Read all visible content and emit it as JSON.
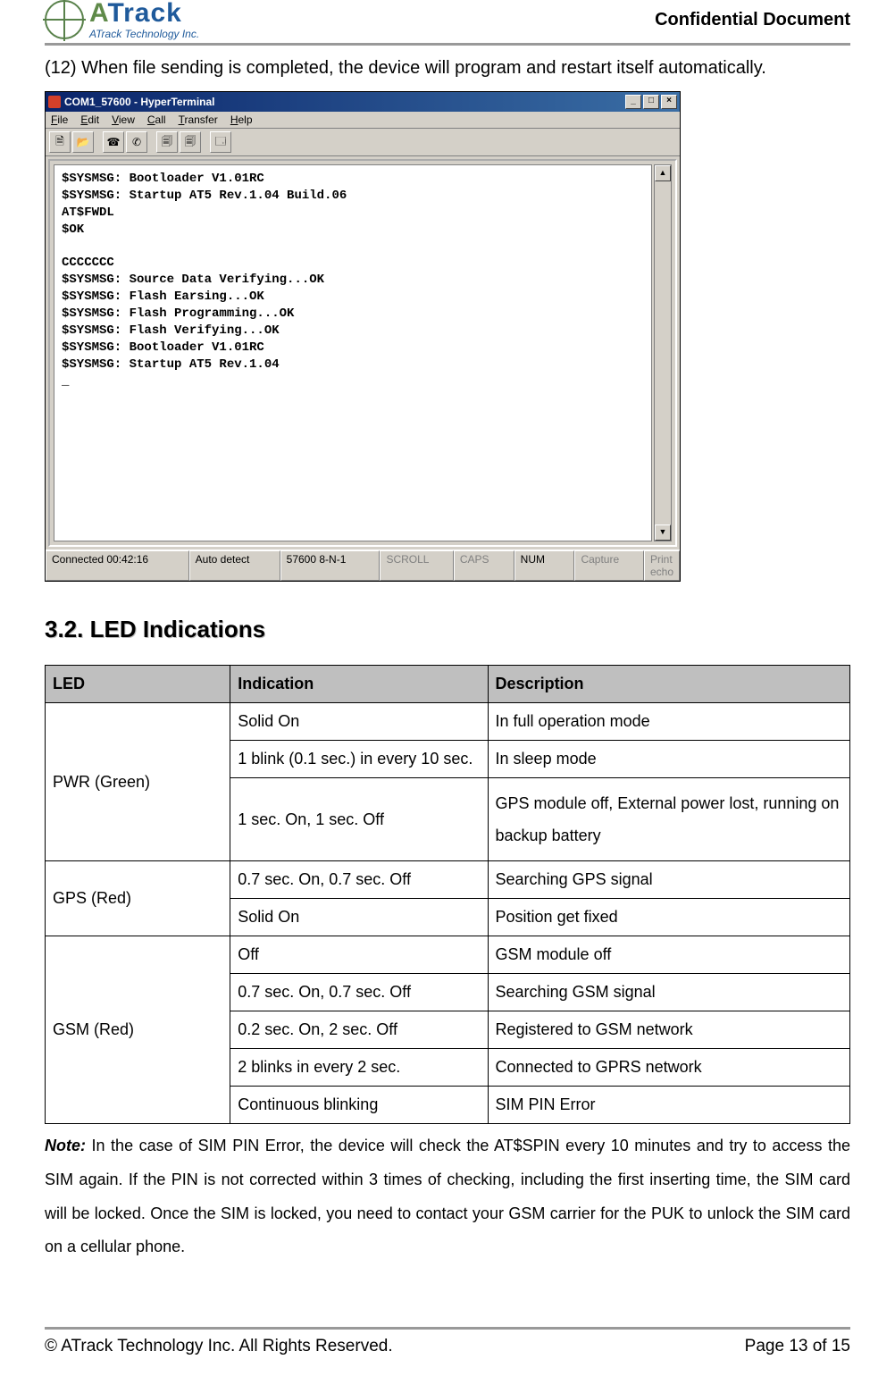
{
  "header": {
    "confidential": "Confidential Document",
    "logo_main_a": "A",
    "logo_main_rest": "Track",
    "logo_sub": "ATrack Technology Inc."
  },
  "intro": "(12) When file sending is completed, the device will program and restart itself automatically.",
  "hyperterminal": {
    "title": "COM1_57600 - HyperTerminal",
    "menu": [
      "File",
      "Edit",
      "View",
      "Call",
      "Transfer",
      "Help"
    ],
    "window_buttons": {
      "min": "_",
      "max": "□",
      "close": "×"
    },
    "toolbar_icons": [
      "new-icon",
      "open-icon",
      "sep",
      "connect-icon",
      "disconnect-icon",
      "sep",
      "send-icon",
      "receive-icon",
      "sep",
      "properties-icon"
    ],
    "terminal_lines": [
      "$SYSMSG: Bootloader V1.01RC",
      "$SYSMSG: Startup AT5 Rev.1.04 Build.06",
      "AT$FWDL",
      "$OK",
      "",
      "CCCCCCC",
      "$SYSMSG: Source Data Verifying...OK",
      "$SYSMSG: Flash Earsing...OK",
      "$SYSMSG: Flash Programming...OK",
      "$SYSMSG: Flash Verifying...OK",
      "$SYSMSG: Bootloader V1.01RC",
      "$SYSMSG: Startup AT5 Rev.1.04",
      "_"
    ],
    "status": {
      "connected": "Connected 00:42:16",
      "auto": "Auto detect",
      "settings": "57600 8-N-1",
      "scroll": "SCROLL",
      "caps": "CAPS",
      "num": "NUM",
      "capture": "Capture",
      "printecho": "Print echo"
    },
    "scroll_up": "▲",
    "scroll_down": "▼"
  },
  "section_title": "3.2. LED Indications",
  "led_table": {
    "headers": [
      "LED",
      "Indication",
      "Description"
    ],
    "groups": [
      {
        "led": "PWR (Green)",
        "rows": [
          {
            "ind": "Solid On",
            "desc": "In full operation mode"
          },
          {
            "ind": "1 blink (0.1 sec.) in every 10 sec.",
            "desc": "In sleep mode"
          },
          {
            "ind": "1 sec. On, 1 sec. Off",
            "desc": "GPS module off, External power lost, running on backup battery"
          }
        ]
      },
      {
        "led": "GPS (Red)",
        "rows": [
          {
            "ind": "0.7 sec. On, 0.7 sec. Off",
            "desc": "Searching GPS signal"
          },
          {
            "ind": "Solid On",
            "desc": "Position get fixed"
          }
        ]
      },
      {
        "led": "GSM (Red)",
        "rows": [
          {
            "ind": "Off",
            "desc": "GSM module off"
          },
          {
            "ind": "0.7 sec. On, 0.7 sec. Off",
            "desc": "Searching GSM signal"
          },
          {
            "ind": "0.2 sec. On, 2 sec. Off",
            "desc": "Registered to GSM network"
          },
          {
            "ind": "2 blinks in every 2 sec.",
            "desc": "Connected to GPRS network"
          },
          {
            "ind": "Continuous blinking",
            "desc": "SIM PIN Error"
          }
        ]
      }
    ]
  },
  "note_label": "Note:",
  "note_text": " In the case of SIM PIN Error, the device will check the AT$SPIN every 10 minutes and try to access the SIM again. If the PIN is not corrected within 3 times of checking, including the first inserting time, the SIM card will be locked. Once the SIM is locked, you need to contact your GSM carrier for the PUK to unlock the SIM card on a cellular phone.",
  "footer": {
    "left": "© ATrack Technology Inc. All Rights Reserved.",
    "right": "Page 13 of 15"
  }
}
